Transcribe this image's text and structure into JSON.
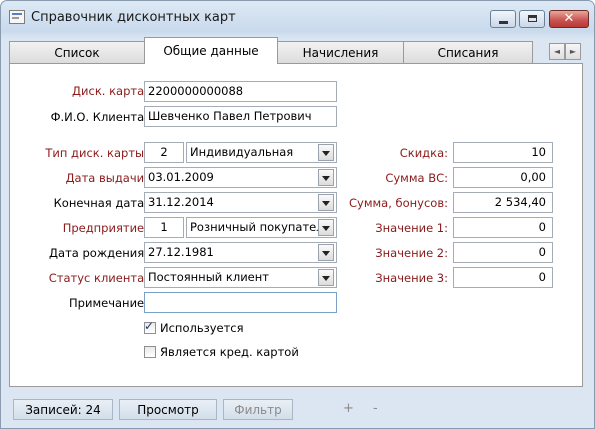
{
  "window": {
    "title": "Справочник дисконтных карт",
    "close_glyph": "✕"
  },
  "tabs": [
    {
      "label": "Список"
    },
    {
      "label": "Общие данные"
    },
    {
      "label": "Начисления"
    },
    {
      "label": "Списания"
    }
  ],
  "tab_scroll": {
    "left": "◄",
    "right": "►"
  },
  "form": {
    "card": {
      "label": "Диск. карта:",
      "value": "2200000000088"
    },
    "client": {
      "label": "Ф.И.О. Клиента:",
      "value": "Шевченко Павел Петрович"
    },
    "card_type": {
      "label": "Тип диск. карты:",
      "code": "2",
      "value": "Индивидуальная"
    },
    "issue_date": {
      "label": "Дата выдачи:",
      "value": "03.01.2009"
    },
    "end_date": {
      "label": "Конечная дата:",
      "value": "31.12.2014"
    },
    "company": {
      "label": "Предприятие:",
      "code": "1",
      "value": "Розничный покупатель"
    },
    "birth_date": {
      "label": "Дата рождения:",
      "value": "27.12.1981"
    },
    "client_status": {
      "label": "Статус клиента:",
      "value": "Постоянный клиент"
    },
    "note": {
      "label": "Примечание:",
      "value": ""
    },
    "used": {
      "label": "Используется",
      "checked": true,
      "mark": "✓"
    },
    "credit_card": {
      "label": "Является кред. картой",
      "checked": false
    }
  },
  "right": {
    "discount": {
      "label": "Скидка:",
      "value": "10"
    },
    "sum_vs": {
      "label": "Сумма ВС:",
      "value": "0,00"
    },
    "bonus_sum": {
      "label": "Сумма, бонусов:",
      "value": "2 534,40"
    },
    "value1": {
      "label": "Значение 1:",
      "value": "0"
    },
    "value2": {
      "label": "Значение 2:",
      "value": "0"
    },
    "value3": {
      "label": "Значение 3:",
      "value": "0"
    }
  },
  "statusbar": {
    "records": "Записей: 24",
    "view": "Просмотр",
    "filter": "Фильтр",
    "plus": "+",
    "minus": "-"
  }
}
